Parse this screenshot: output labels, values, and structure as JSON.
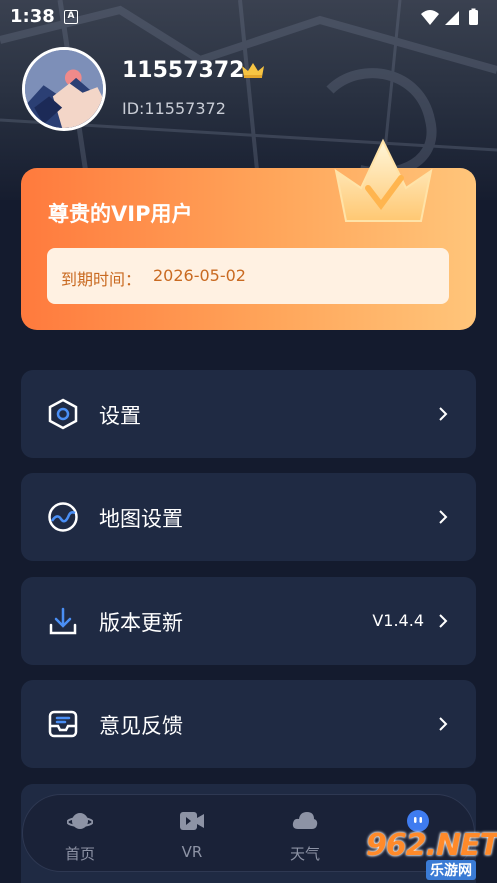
{
  "status_bar": {
    "time": "1:38",
    "notification_icon": "a-letter-icon"
  },
  "profile": {
    "username": "11557372",
    "user_id": "ID:11557372",
    "crown_icon": "crown-icon"
  },
  "vip_card": {
    "title": "尊贵的VIP用户",
    "expire_label": "到期时间：",
    "expire_date": "2026-05-02"
  },
  "menu": {
    "items": [
      {
        "label": "设置",
        "icon": "hexagon-settings-icon",
        "value": ""
      },
      {
        "label": "地图设置",
        "icon": "globe-map-icon",
        "value": ""
      },
      {
        "label": "版本更新",
        "icon": "download-icon",
        "value": "V1.4.4"
      },
      {
        "label": "意见反馈",
        "icon": "feedback-inbox-icon",
        "value": ""
      }
    ]
  },
  "tab_bar": {
    "tabs": [
      {
        "label": "首页",
        "icon": "planet-icon"
      },
      {
        "label": "VR",
        "icon": "video-camera-icon"
      },
      {
        "label": "天气",
        "icon": "cloud-icon"
      },
      {
        "label": "",
        "icon": "profile-face-icon"
      }
    ]
  },
  "watermark": {
    "main": "962.NET",
    "sub": "乐游网"
  },
  "colors": {
    "background": "#141b2e",
    "card": "#1f2a43",
    "vip_orange": "#ff7a3d",
    "expire_text": "#c96a21",
    "active_tab": "#3f7cf0"
  }
}
